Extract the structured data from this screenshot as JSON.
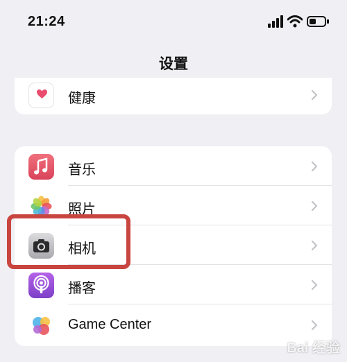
{
  "status_bar": {
    "time": "21:24"
  },
  "nav": {
    "title": "设置"
  },
  "groups": {
    "top": [
      {
        "label": "健康",
        "icon": "heart-icon"
      }
    ],
    "main": [
      {
        "label": "音乐",
        "icon": "music-note-icon"
      },
      {
        "label": "照片",
        "icon": "photos-flower-icon"
      },
      {
        "label": "相机",
        "icon": "camera-icon"
      },
      {
        "label": "播客",
        "icon": "podcast-icon"
      },
      {
        "label": "Game Center",
        "icon": "game-center-icon"
      }
    ]
  },
  "watermark": "Bai 经验",
  "colors": {
    "background": "#efeff4",
    "highlight": "#c9453f",
    "music": "#e85a6a",
    "podcast": "#8e44d8"
  }
}
